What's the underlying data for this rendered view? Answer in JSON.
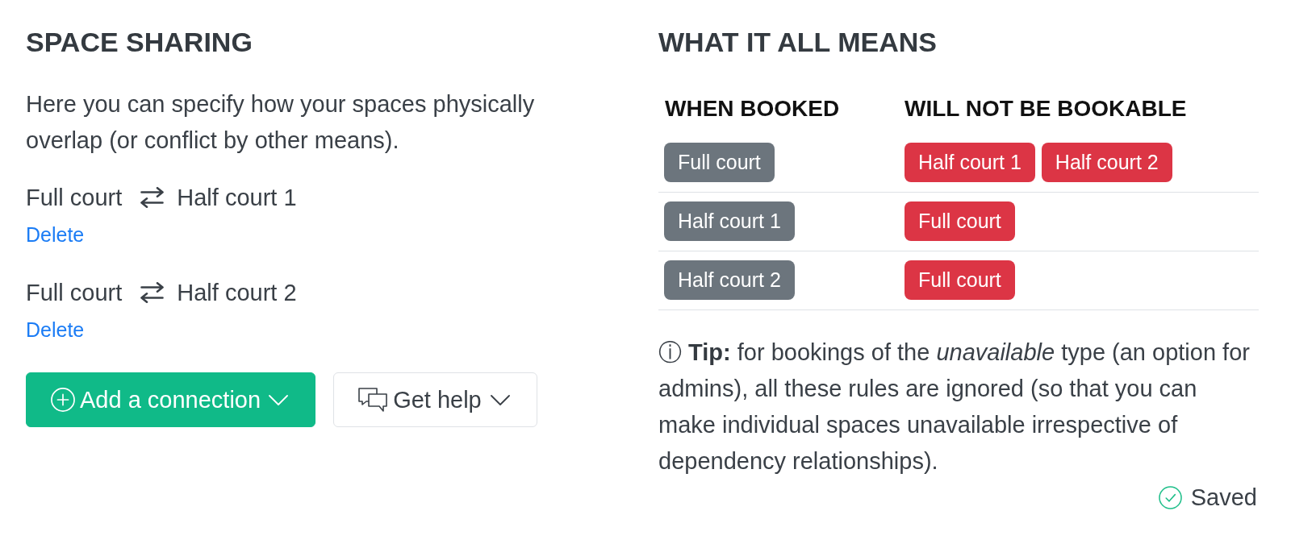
{
  "space_sharing": {
    "title": "SPACE SHARING",
    "description": "Here you can specify how your spaces physically overlap (or conflict by other means).",
    "connections": [
      {
        "from": "Full court",
        "to": "Half court 1",
        "action": "Delete"
      },
      {
        "from": "Full court",
        "to": "Half court 2",
        "action": "Delete"
      }
    ],
    "buttons": [
      {
        "kind": "add",
        "label": "Add a connection"
      },
      {
        "kind": "help",
        "label": "Get help"
      }
    ]
  },
  "what_it_all_means": {
    "title": "WHAT IT ALL MEANS",
    "columns": [
      "WHEN BOOKED",
      "WILL NOT BE BOOKABLE"
    ],
    "rows": [
      {
        "when_booked": "Full court",
        "will_not_be_bookable": [
          "Half court 1",
          "Half court 2"
        ]
      },
      {
        "when_booked": "Half court 1",
        "will_not_be_bookable": [
          "Full court"
        ]
      },
      {
        "when_booked": "Half court 2",
        "will_not_be_bookable": [
          "Full court"
        ]
      }
    ],
    "tip": "ⓘ **Tip:** for bookings of the *unavailable* type (an option for admins), all these rules are ignored (so that you can make individual spaces unavailable irrespective of dependency relationships).",
    "status": "Saved"
  }
}
